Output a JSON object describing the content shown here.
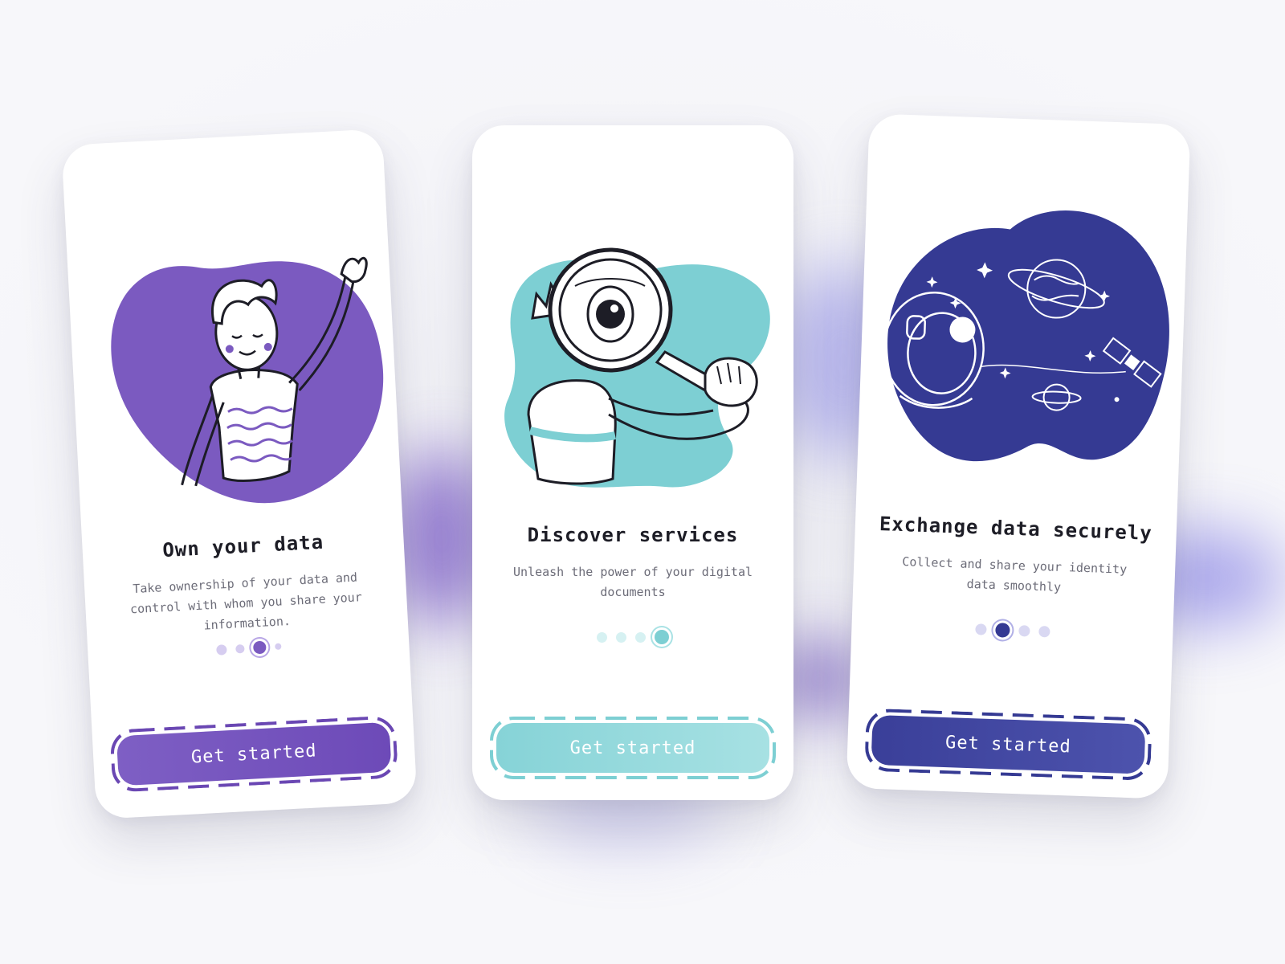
{
  "colors": {
    "background": "#f4f4f8",
    "purple": "#7b5ac0",
    "teal": "#7dcfd3",
    "navy": "#353a93"
  },
  "screens": [
    {
      "title": "Own your data",
      "subtitle": "Take ownership of your data and control with whom you share your information.",
      "button_label": "Get started",
      "illustration": "person-raising-hand-illustration",
      "page_dots": {
        "count": 4,
        "active_index": 2
      }
    },
    {
      "title": "Discover services",
      "subtitle": "Unleash the power of your digital documents",
      "button_label": "Get started",
      "illustration": "magnifying-glass-person-illustration",
      "page_dots": {
        "count": 4,
        "active_index": 3
      }
    },
    {
      "title": "Exchange data securely",
      "subtitle": "Collect and share your identity data smoothly",
      "button_label": "Get started",
      "illustration": "astronaut-space-illustration",
      "page_dots": {
        "count": 4,
        "active_index": 1
      }
    }
  ]
}
